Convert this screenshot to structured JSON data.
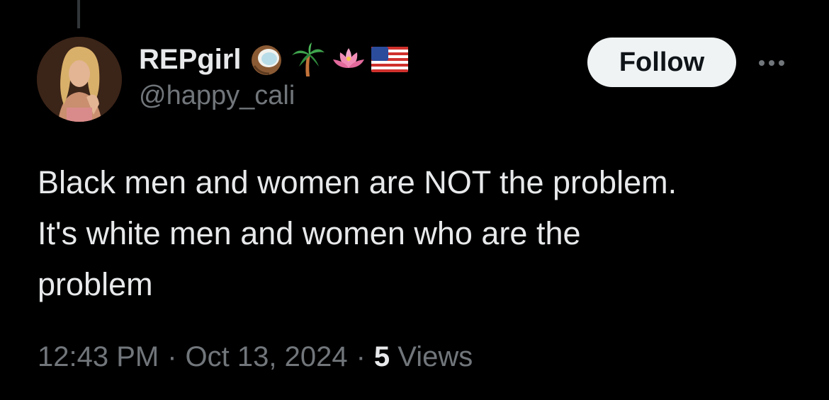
{
  "tweet": {
    "author": {
      "display_name": "REPgirl",
      "handle": "@happy_cali",
      "avatar_icon": "profile-photo",
      "name_emojis": [
        "coconut-icon",
        "palm-tree-icon",
        "lotus-icon",
        "us-flag-icon"
      ]
    },
    "follow_label": "Follow",
    "more_icon": "more-horizontal-icon",
    "text": "Black men and women are NOT the problem.\nIt's white men and women who are the\nproblem",
    "time": "12:43 PM",
    "date": "Oct 13, 2024",
    "separator": "·",
    "views_count": "5",
    "views_label": "Views"
  },
  "colors": {
    "background": "#000000",
    "primary_text": "#e7e9ea",
    "secondary_text": "#71767b",
    "follow_bg": "#eff3f4",
    "follow_text": "#0f1419"
  }
}
